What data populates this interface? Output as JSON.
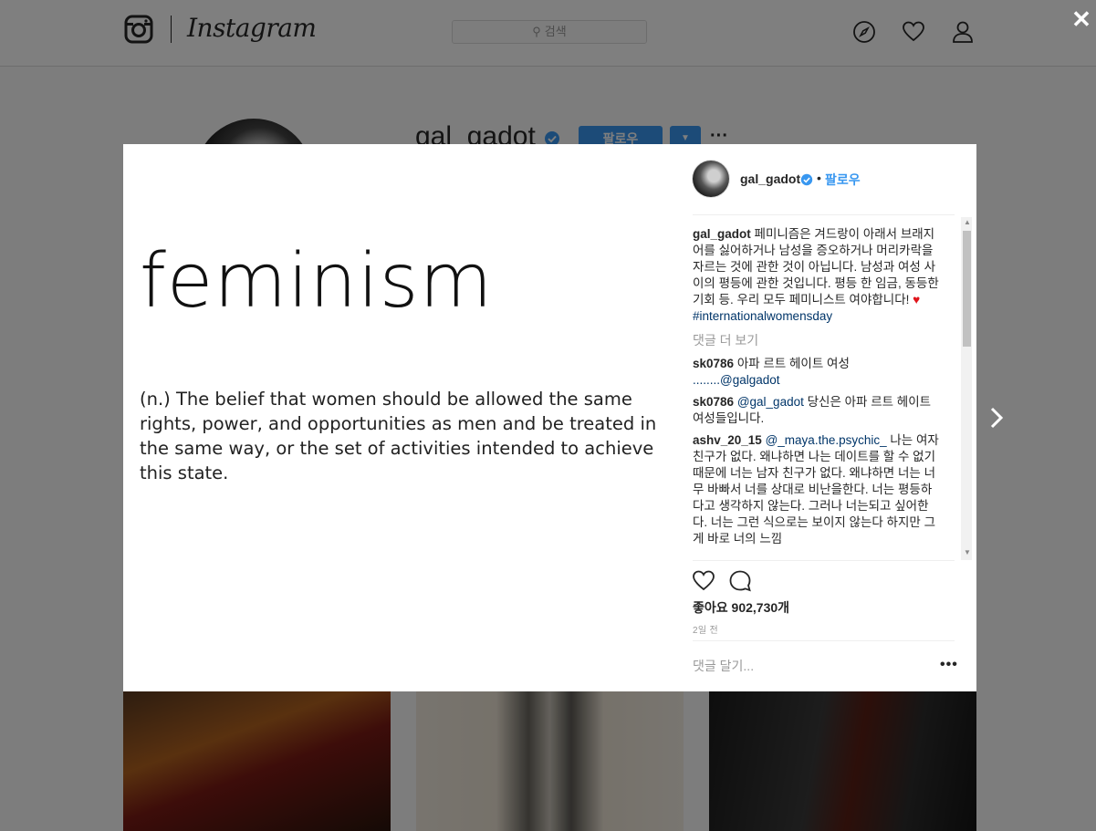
{
  "topbar": {
    "logo_text": "Instagram",
    "search_placeholder": "검색",
    "nav_icons": [
      "compass-icon",
      "heart-icon",
      "person-icon"
    ]
  },
  "profile": {
    "username": "gal_gadot",
    "follow_label": "팔로우",
    "dropdown_label": "▼",
    "more_label": "···"
  },
  "modal": {
    "close_label": "✕",
    "image": {
      "headline": "feminism",
      "definition": "(n.) The belief that women should be allowed the same rights, power, and opportunities as men and be treated in the same way, or the set of activities intended to achieve this state."
    },
    "header": {
      "username": "gal_gadot",
      "separator": "•",
      "follow_label": "팔로우"
    },
    "caption": {
      "user": "gal_gadot",
      "text": "페미니즘은 겨드랑이 아래서 브래지어를 싫어하거나 남성을 증오하거나 머리카락을 자르는 것에 관한 것이 아닙니다. 남성과 여성 사이의 평등에 관한 것입니다. 평등 한 임금, 동등한 기회 등. 우리 모두 페미니스트 여야합니다!",
      "emoji": "♥",
      "hashtag": "#internationalwomensday"
    },
    "load_more": "댓글 더 보기",
    "comments": [
      {
        "user": "sk0786",
        "text": "아파 르트 헤이트 여성",
        "mention": "........@galgadot",
        "text_after": ""
      },
      {
        "user": "sk0786",
        "mention": "@gal_gadot",
        "text": "당신은 아파 르트 헤이트 여성들입니다."
      },
      {
        "user": "ashv_20_15",
        "mention": "@_maya.the.psychic_",
        "text": "나는 여자 친구가 없다. 왜냐하면 나는 데이트를 할 수 없기 때문에 너는 남자 친구가 없다. 왜냐하면 너는 너무 바빠서 너를 상대로 비난을한다. 너는 평등하다고 생각하지 않는다. 그러나 너는되고 싶어한다. 너는 그런 식으로는 보이지 않는다 하지만 그게 바로 너의 느낌"
      }
    ],
    "likes_text": "좋아요 902,730개",
    "timestamp": "2일 전",
    "add_comment_placeholder": "댓글 달기...",
    "options_label": "•••"
  }
}
